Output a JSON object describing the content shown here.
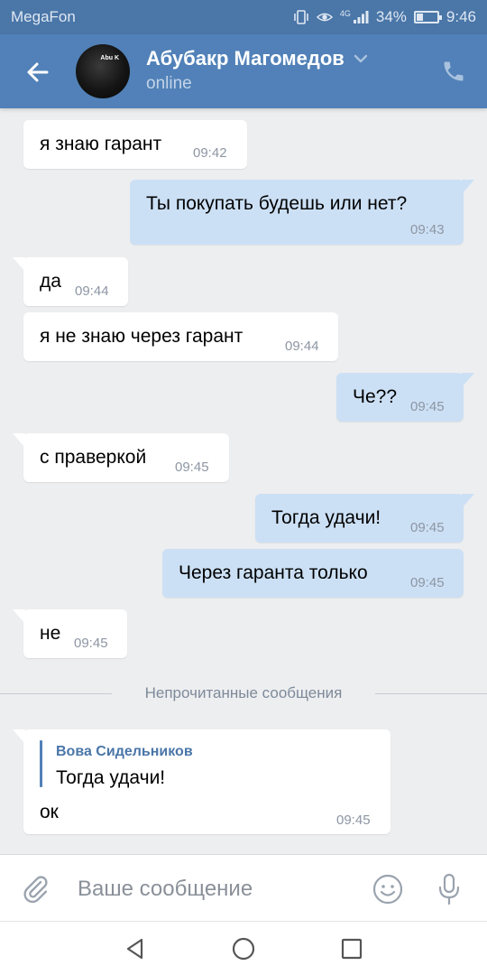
{
  "status_bar": {
    "carrier": "MegaFon",
    "network": "4G",
    "battery": "34%",
    "battery_level": 0.34,
    "time": "9:46"
  },
  "header": {
    "contact_name": "Абубакр Магомедов",
    "status": "online",
    "avatar_text": "Abu K"
  },
  "messages": [
    {
      "dir": "in",
      "text": "я знаю гарант",
      "time": "09:42"
    },
    {
      "dir": "out",
      "text": "Ты покупать будешь или нет?",
      "time": "09:43"
    },
    {
      "dir": "in",
      "text": "да",
      "time": "09:44"
    },
    {
      "dir": "in",
      "text": "я не знаю через гарант",
      "time": "09:44"
    },
    {
      "dir": "out",
      "text": "Че??",
      "time": "09:45"
    },
    {
      "dir": "in",
      "text": "с праверкой",
      "time": "09:45"
    },
    {
      "dir": "out",
      "text": "Тогда удачи!",
      "time": "09:45"
    },
    {
      "dir": "out",
      "text": "Через гаранта только",
      "time": "09:45"
    },
    {
      "dir": "in",
      "text": "не",
      "time": "09:45"
    }
  ],
  "unread_divider": "Непрочитанные сообщения",
  "last_message": {
    "reply_author": "Вова Сидельников",
    "reply_text": "Тогда удачи!",
    "text": "ок",
    "time": "09:45"
  },
  "input": {
    "placeholder": "Ваше сообщение"
  },
  "colors": {
    "header": "#5181b8",
    "status_bar": "#4a76a8",
    "outgoing_bubble": "#cce0f5",
    "incoming_bubble": "#ffffff",
    "background": "#edeef0"
  },
  "icons": {
    "back": "arrow-left-icon",
    "call": "phone-icon",
    "dropdown": "chevron-down-icon",
    "attach": "paperclip-icon",
    "emoji": "smiley-icon",
    "mic": "microphone-icon",
    "nav_back": "triangle-back-icon",
    "nav_home": "circle-home-icon",
    "nav_recents": "square-recents-icon"
  }
}
